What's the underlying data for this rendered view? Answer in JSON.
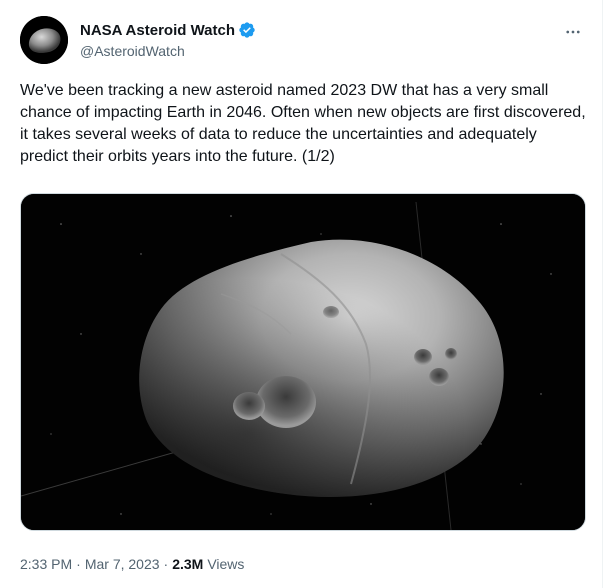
{
  "author": {
    "display_name": "NASA Asteroid Watch",
    "handle": "@AsteroidWatch",
    "verified": true,
    "verified_color": "#1d9bf0",
    "avatar_icon": "asteroid-avatar-icon"
  },
  "more_icon": "more-horizontal-icon",
  "tweet": {
    "text": "We've been tracking a new asteroid named 2023 DW that has a very small chance of impacting Earth in 2046. Often when new objects are first discovered, it takes several weeks of data to reduce the uncertainties and adequately predict their orbits years into the future. (1/2)"
  },
  "media": {
    "kind": "image",
    "subject": "asteroid-image"
  },
  "meta": {
    "time": "2:33 PM",
    "separator": "·",
    "date": "Mar 7, 2023",
    "separator2": "·",
    "views_count": "2.3M",
    "views_label": "Views"
  },
  "colors": {
    "text_primary": "#0f1419",
    "text_secondary": "#536471",
    "border": "#cfd9de"
  }
}
